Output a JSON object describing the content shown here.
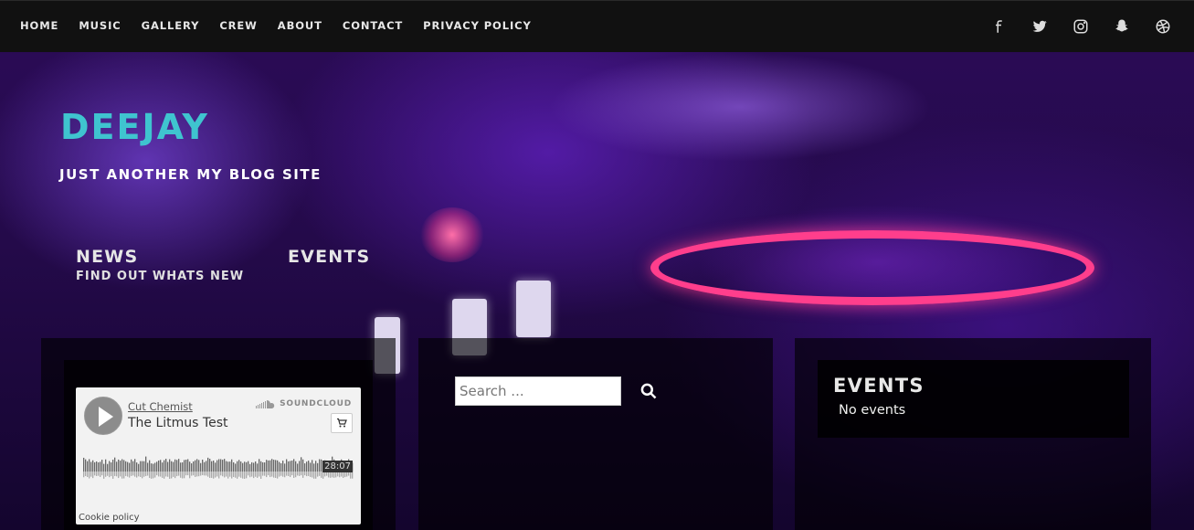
{
  "nav": {
    "items": [
      "HOME",
      "MUSIC",
      "GALLERY",
      "CREW",
      "ABOUT",
      "CONTACT",
      "PRIVACY POLICY"
    ]
  },
  "social": [
    "facebook-icon",
    "twitter-icon",
    "instagram-icon",
    "snapchat-icon",
    "dribbble-icon"
  ],
  "site": {
    "title": "DEEJAY",
    "tagline": "JUST ANOTHER MY BLOG SITE",
    "title_color": "#3fc4cf"
  },
  "hero_links": {
    "news": {
      "heading": "NEWS",
      "sub": "FIND OUT WHATS NEW"
    },
    "events": {
      "heading": "EVENTS"
    }
  },
  "soundcloud": {
    "artist": "Cut Chemist",
    "track": "The Litmus Test",
    "brand": "SOUNDCLOUD",
    "duration": "28:07",
    "cookie": "Cookie policy"
  },
  "search": {
    "placeholder": "Search ..."
  },
  "events_widget": {
    "title": "EVENTS",
    "empty_text": "No events"
  }
}
